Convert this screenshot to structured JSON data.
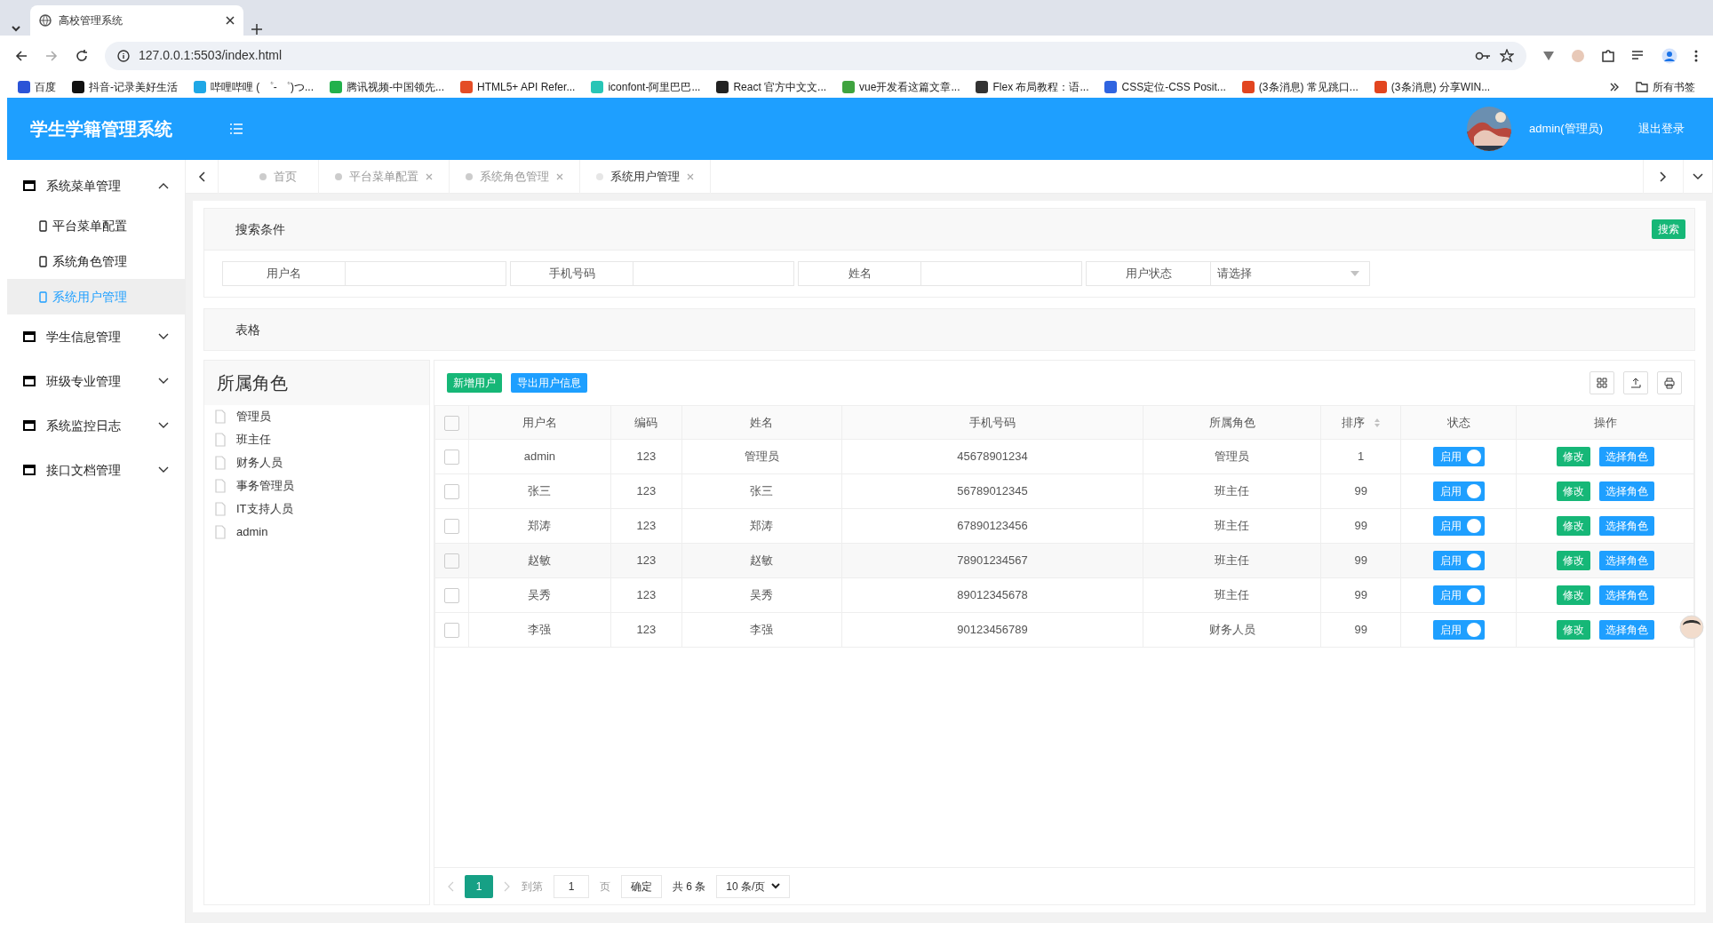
{
  "browser": {
    "tab_title": "高校管理系统",
    "url": "127.0.0.1:5503/index.html",
    "bookmarks": [
      "百度",
      "抖音-记录美好生活",
      "哔哩哔哩 ( ゜- ゜)つ...",
      "腾讯视频-中国领先...",
      "HTML5+ API Refer...",
      "iconfont-阿里巴巴...",
      "React 官方中文文...",
      "vue开发看这篇文章...",
      "Flex 布局教程：语...",
      "CSS定位-CSS Posit...",
      "(3条消息) 常见跳口...",
      "(3条消息) 分享WIN..."
    ],
    "all_bookmarks": "所有书签"
  },
  "app": {
    "title": "学生学籍管理系统",
    "user": "admin(管理员)",
    "logout": "退出登录"
  },
  "sidebar": [
    {
      "label": "系统菜单管理",
      "expanded": true,
      "children": [
        {
          "label": "平台菜单配置",
          "selected": false
        },
        {
          "label": "系统角色管理",
          "selected": false
        },
        {
          "label": "系统用户管理",
          "selected": true
        }
      ]
    },
    {
      "label": "学生信息管理",
      "expanded": false
    },
    {
      "label": "班级专业管理",
      "expanded": false
    },
    {
      "label": "系统监控日志",
      "expanded": false
    },
    {
      "label": "接口文档管理",
      "expanded": false
    }
  ],
  "tabs": [
    {
      "label": "首页",
      "selected": false,
      "closable": false
    },
    {
      "label": "平台菜单配置",
      "selected": false,
      "closable": true
    },
    {
      "label": "系统角色管理",
      "selected": false,
      "closable": true
    },
    {
      "label": "系统用户管理",
      "selected": true,
      "closable": true
    }
  ],
  "search": {
    "title": "搜索条件",
    "button": "搜索",
    "fields": [
      {
        "label": "用户名",
        "kind": "text"
      },
      {
        "label": "手机号码",
        "kind": "text"
      },
      {
        "label": "姓名",
        "kind": "text"
      },
      {
        "label": "用户状态",
        "kind": "select",
        "placeholder": "请选择"
      }
    ]
  },
  "table_title": "表格",
  "roles": {
    "title": "所属角色",
    "items": [
      "管理员",
      "班主任",
      "财务人员",
      "事务管理员",
      "IT支持人员",
      "admin"
    ]
  },
  "toolbar": [
    "新增用户",
    "导出用户信息"
  ],
  "select_all": {
    "checked": false
  },
  "columns": [
    {
      "label": "用户名",
      "sortable": false
    },
    {
      "label": "编码",
      "sortable": false
    },
    {
      "label": "姓名",
      "sortable": false
    },
    {
      "label": "手机号码",
      "sortable": false
    },
    {
      "label": "所属角色",
      "sortable": false
    },
    {
      "label": "排序",
      "sortable": true
    },
    {
      "label": "状态",
      "sortable": false
    },
    {
      "label": "操作",
      "sortable": false
    }
  ],
  "rows": [
    {
      "username": "admin",
      "code": "123",
      "name": "管理员",
      "phone": "45678901234",
      "role": "管理员",
      "order": "1",
      "checked": false,
      "status": "启用",
      "enabled": true,
      "edit": "修改",
      "assign": "选择角色"
    },
    {
      "username": "张三",
      "code": "123",
      "name": "张三",
      "phone": "56789012345",
      "role": "班主任",
      "order": "99",
      "checked": false,
      "status": "启用",
      "enabled": true,
      "edit": "修改",
      "assign": "选择角色"
    },
    {
      "username": "郑涛",
      "code": "123",
      "name": "郑涛",
      "phone": "67890123456",
      "role": "班主任",
      "order": "99",
      "checked": false,
      "status": "启用",
      "enabled": true,
      "edit": "修改",
      "assign": "选择角色"
    },
    {
      "username": "赵敏",
      "code": "123",
      "name": "赵敏",
      "phone": "78901234567",
      "role": "班主任",
      "order": "99",
      "checked": false,
      "status": "启用",
      "enabled": true,
      "edit": "修改",
      "assign": "选择角色"
    },
    {
      "username": "吴秀",
      "code": "123",
      "name": "吴秀",
      "phone": "89012345678",
      "role": "班主任",
      "order": "99",
      "checked": false,
      "status": "启用",
      "enabled": true,
      "edit": "修改",
      "assign": "选择角色"
    },
    {
      "username": "李强",
      "code": "123",
      "name": "李强",
      "phone": "90123456789",
      "role": "财务人员",
      "order": "99",
      "checked": false,
      "status": "启用",
      "enabled": true,
      "edit": "修改",
      "assign": "选择角色"
    }
  ],
  "pagination": {
    "current": "1",
    "goto": "到第",
    "page_value": "1",
    "page_unit": "页",
    "confirm": "确定",
    "total": "共 6 条",
    "page_size": "10 条/页"
  }
}
